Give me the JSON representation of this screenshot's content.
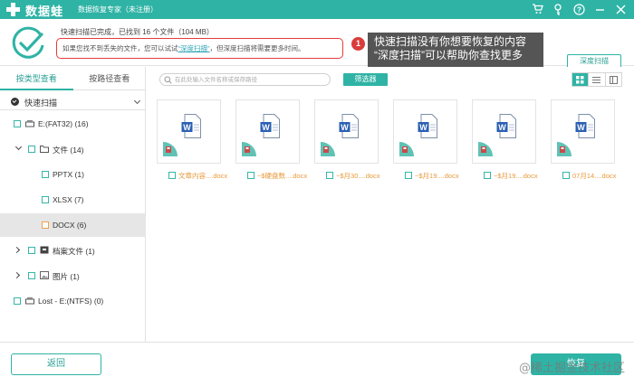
{
  "app": {
    "name": "数据蛙",
    "subtitle": "数据恢复专家（未注册）"
  },
  "colors": {
    "accent": "#2fb3a5",
    "alert_red": "#e23c3c",
    "file_name_orange": "#e89a3c",
    "callout_bg": "#555555"
  },
  "titlebar_icons": [
    "cart-icon",
    "key-icon",
    "help-icon",
    "minimize-icon",
    "close-icon"
  ],
  "status": {
    "line1": "快速扫描已完成，已找到 16 个文件（104 MB）",
    "hint_prefix": "如果您找不到丢失的文件，您可以试试",
    "hint_link": "“深度扫描”",
    "hint_suffix": "，但深度扫描将需要更多时间。",
    "badge": "1",
    "callout_line1": "快速扫描没有你想要恢复的内容",
    "callout_line2": "“深度扫描”可以帮助你查找更多",
    "deep_scan_button": "深度扫描"
  },
  "sidebar": {
    "tabs": [
      {
        "label": "按类型查看",
        "active": true
      },
      {
        "label": "按路径查看",
        "active": false
      }
    ],
    "scan_mode": "快速扫描",
    "tree": [
      {
        "label": "E:(FAT32) (16)",
        "icon": "drive-icon",
        "expand": "down",
        "selected": false
      },
      {
        "label": "文件 (14)",
        "icon": "folder-icon",
        "expand": "down",
        "selected": false
      },
      {
        "label": "PPTX (1)",
        "icon": "",
        "expand": "",
        "selected": false
      },
      {
        "label": "XLSX (7)",
        "icon": "",
        "expand": "",
        "selected": false
      },
      {
        "label": "DOCX (6)",
        "icon": "",
        "expand": "",
        "selected": true
      },
      {
        "label": "档案文件 (1)",
        "icon": "archive-icon",
        "expand": "right",
        "selected": false
      },
      {
        "label": "图片 (1)",
        "icon": "image-icon",
        "expand": "right",
        "selected": false
      },
      {
        "label": "Lost - E:(NTFS) (0)",
        "icon": "drive-icon",
        "expand": "",
        "selected": false
      }
    ]
  },
  "main": {
    "search_placeholder": "在此处输入文件名称或保存路径",
    "filter_button": "筛选器",
    "view_modes": [
      "grid-view-icon",
      "list-view-icon",
      "detail-view-icon"
    ],
    "files": [
      {
        "name": "文章内容....docx"
      },
      {
        "name": "~$硬盘数....docx"
      },
      {
        "name": "~$月30....docx"
      },
      {
        "name": "~$月19....docx"
      },
      {
        "name": "~$月19....docx"
      },
      {
        "name": "07月14....docx"
      }
    ]
  },
  "footer": {
    "back_button": "返回",
    "recover_button": "恢复",
    "watermark": "@稀土掘金技术社区"
  }
}
